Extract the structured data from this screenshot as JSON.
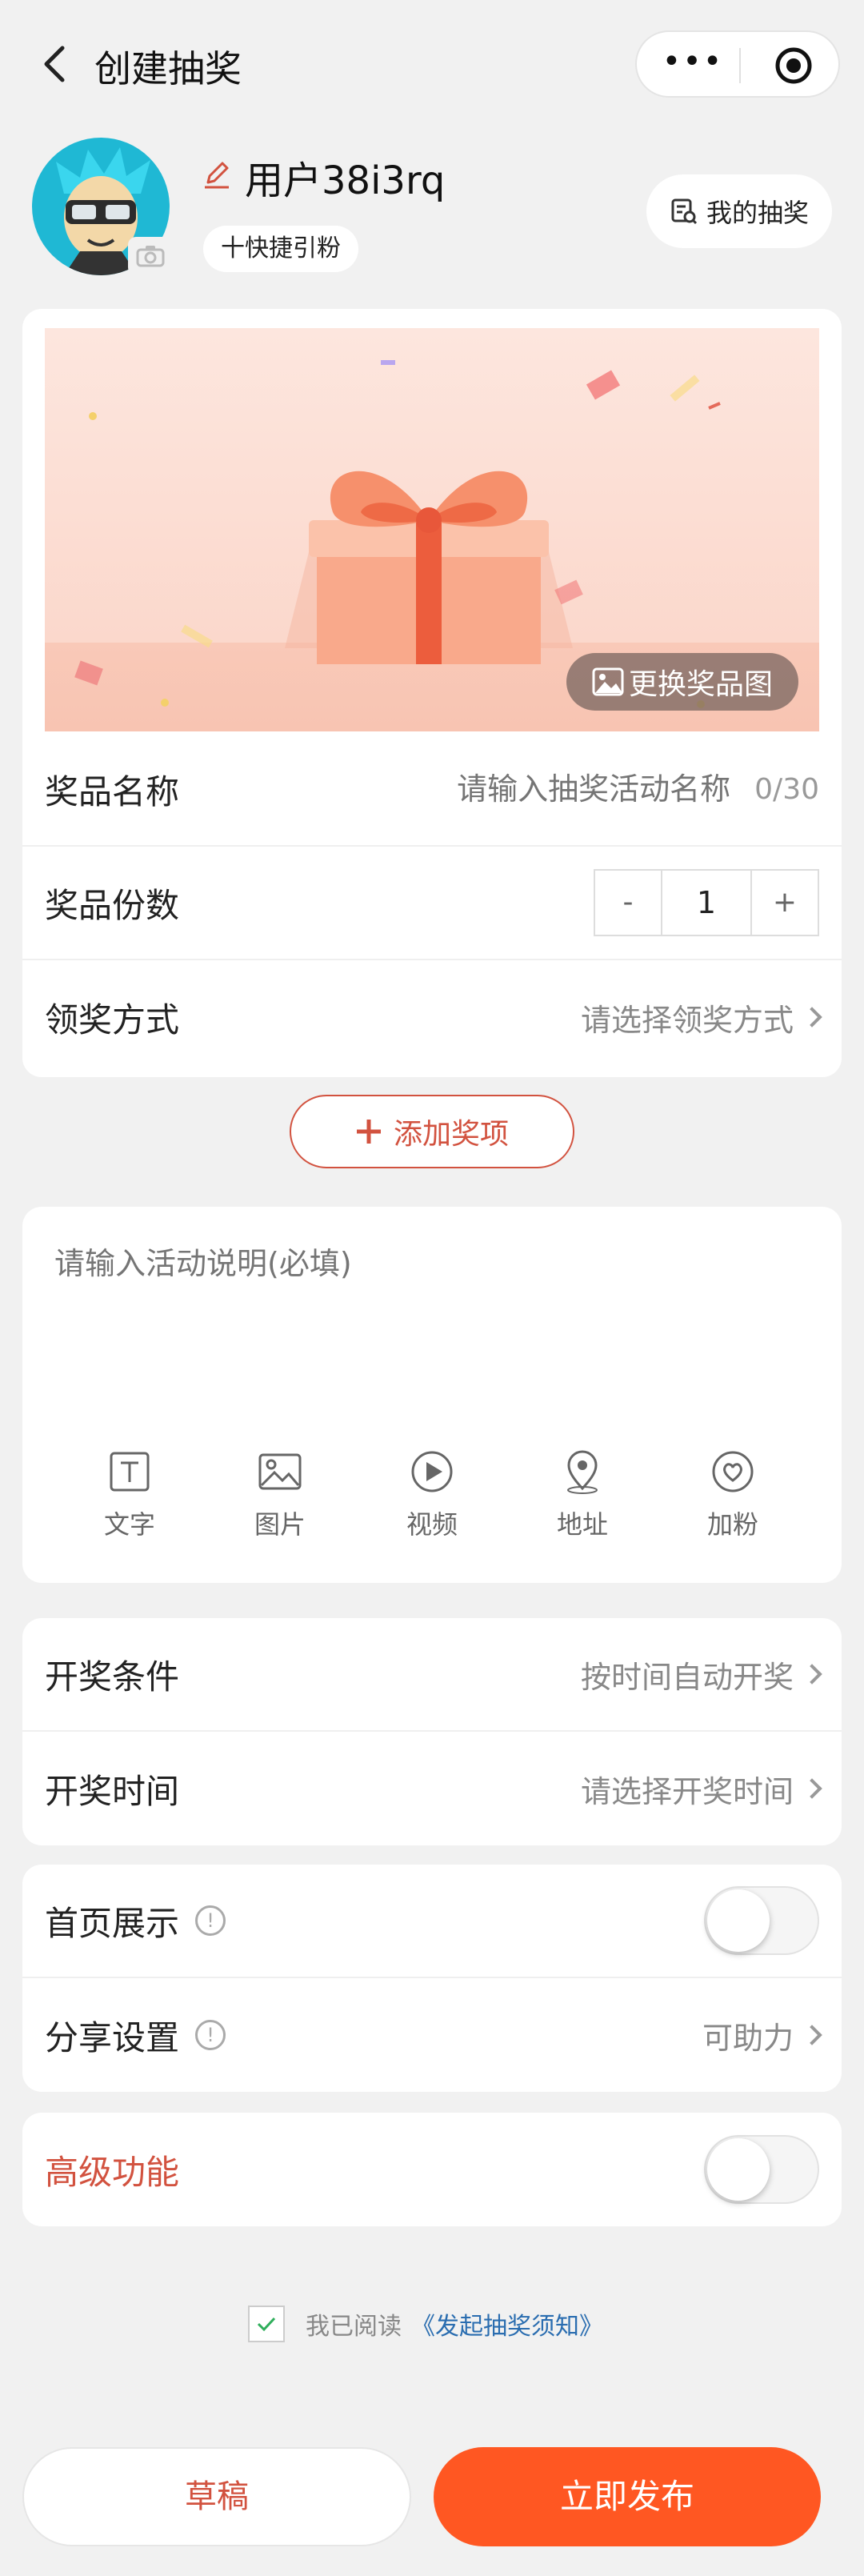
{
  "header": {
    "title": "创建抽奖",
    "more_label": "•••"
  },
  "profile": {
    "username": "用户38i3rq",
    "quick_fans": "十快捷引粉",
    "my_lottery": "我的抽奖"
  },
  "prize": {
    "change_image": "更换奖品图",
    "name_label": "奖品名称",
    "name_placeholder": "请输入抽奖活动名称",
    "name_count": "0/30",
    "qty_label": "奖品份数",
    "qty_minus": "-",
    "qty_value": "1",
    "qty_plus": "+",
    "claim_label": "领奖方式",
    "claim_value": "请选择领奖方式"
  },
  "add_prize": "添加奖项",
  "description": {
    "placeholder": "请输入活动说明(必填)",
    "tools": [
      "文字",
      "图片",
      "视频",
      "地址",
      "加粉"
    ]
  },
  "draw": {
    "condition_label": "开奖条件",
    "condition_value": "按时间自动开奖",
    "time_label": "开奖时间",
    "time_value": "请选择开奖时间"
  },
  "display": {
    "home_label": "首页展示",
    "share_label": "分享设置",
    "share_value": "可助力",
    "info_icon": "!"
  },
  "advanced": {
    "label": "高级功能"
  },
  "agreement": {
    "prefix": "我已阅读",
    "link": "《发起抽奖须知》",
    "checked": true
  },
  "footer": {
    "draft": "草稿",
    "publish": "立即发布"
  },
  "colors": {
    "accent": "#ff5722",
    "red": "#d2523f",
    "link": "#2a6db0"
  }
}
